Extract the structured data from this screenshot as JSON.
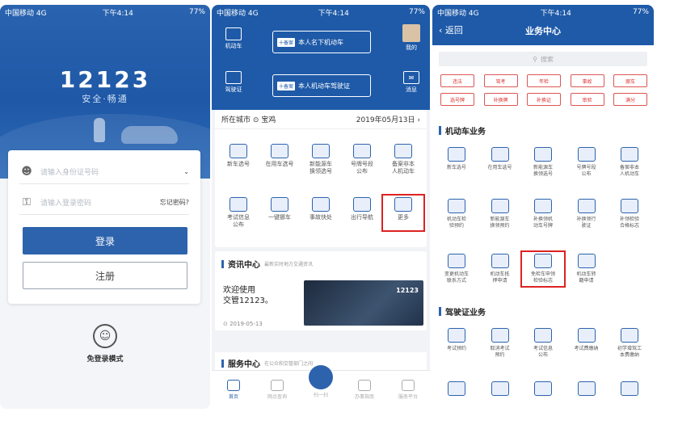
{
  "phone1": {
    "status": {
      "carrier": "中国移动 4G",
      "time": "下午4:14",
      "battery": "77%"
    },
    "logo": {
      "title": "12123",
      "subtitle": "安全·畅通"
    },
    "id_field": {
      "placeholder": "请输入身份证号码",
      "icon": "user-icon",
      "chevron": "chevron-down-icon"
    },
    "password_field": {
      "placeholder": "请输入登录密码",
      "icon": "key-icon",
      "forgot": "忘记密码?"
    },
    "login_label": "登录",
    "register_label": "注册",
    "guest": {
      "label": "免登录模式",
      "icon": "user-circle-icon"
    }
  },
  "phone2": {
    "status": {
      "carrier": "中国移动 4G",
      "time": "下午4:14",
      "battery": "77%"
    },
    "top_left": [
      {
        "label": "机动车"
      },
      {
        "label": "驾驶证"
      }
    ],
    "banners": [
      {
        "tag": "十备案",
        "label": "本人名下机动车"
      },
      {
        "tag": "十备案",
        "label": "本人机动车驾驶证"
      }
    ],
    "top_right": [
      {
        "label": "我的"
      },
      {
        "label": "消息"
      }
    ],
    "city": {
      "label": "所在城市",
      "value": "宝鸡",
      "date": "2019年05月13日"
    },
    "grid_row1": [
      {
        "label": "新车选号"
      },
      {
        "label": "在用车选号"
      },
      {
        "label": "新能源车\n换领选号"
      },
      {
        "label": "号牌号段\n公布"
      },
      {
        "label": "备案非本\n人机动车"
      }
    ],
    "grid_row2": [
      {
        "label": "考试信息\n公布"
      },
      {
        "label": "一键挪车"
      },
      {
        "label": "事故快处"
      },
      {
        "label": "出行导航"
      },
      {
        "label": "更多"
      }
    ],
    "news": {
      "title": "资讯中心",
      "subtitle": "最新实时地方交通资讯",
      "text": "欢迎使用\n交管12123。",
      "date": "2019-05-13",
      "img_text": "12123"
    },
    "service": {
      "title": "服务中心",
      "subtitle": "在公众和交管部门之间"
    },
    "tabs": [
      {
        "label": "首页"
      },
      {
        "label": "网点查询"
      },
      {
        "label": "扫一扫"
      },
      {
        "label": "办事指南"
      },
      {
        "label": "服务平台"
      }
    ]
  },
  "phone3": {
    "status": {
      "carrier": "中国移动 4G",
      "time": "下午4:14",
      "battery": "77%"
    },
    "back": "返回",
    "title": "业务中心",
    "search": "搜索",
    "chips_row1": [
      "违法",
      "驾考",
      "年检",
      "事故",
      "挪车"
    ],
    "chips_row2": [
      "选号牌",
      "补换牌",
      "补换证",
      "审验",
      "满分"
    ],
    "section_vehicle": "机动车业务",
    "vehicle_row1": [
      {
        "label": "新车选号"
      },
      {
        "label": "在用车选号"
      },
      {
        "label": "新能源车\n换领选号"
      },
      {
        "label": "号牌号段\n公布"
      },
      {
        "label": "备案非本\n人机动车"
      }
    ],
    "vehicle_row2": [
      {
        "label": "机动车检\n验预约"
      },
      {
        "label": "新能源车\n换领预约"
      },
      {
        "label": "补换领机\n动车号牌"
      },
      {
        "label": "补换领行\n驶证"
      },
      {
        "label": "补领检验\n合格标志"
      }
    ],
    "vehicle_row3": [
      {
        "label": "变更机动车\n联系方式"
      },
      {
        "label": "机动车抵\n押申请"
      },
      {
        "label": "免检车申领\n检验标志"
      },
      {
        "label": "机动车转\n籍申请"
      }
    ],
    "section_license": "驾驶证业务",
    "license_row1": [
      {
        "label": "考试预约"
      },
      {
        "label": "取消考试\n预约"
      },
      {
        "label": "考试信息\n公布"
      },
      {
        "label": "考试费缴纳"
      },
      {
        "label": "初学增驾工\n本费缴纳"
      }
    ]
  }
}
